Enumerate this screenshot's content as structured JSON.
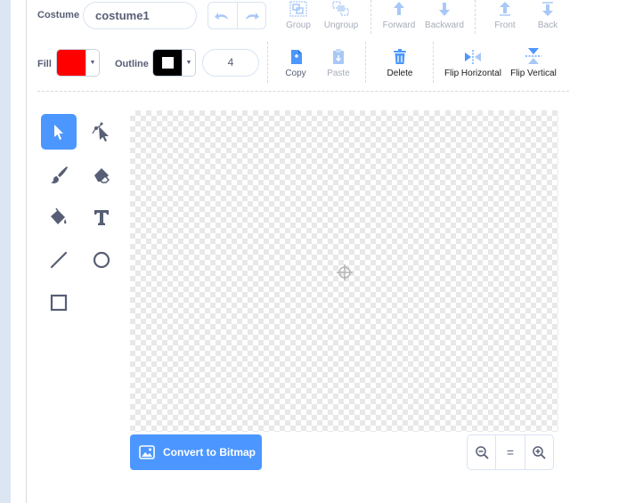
{
  "costume": {
    "label": "Costume",
    "name_value": "costume1"
  },
  "toolbar": {
    "group_label": "Group",
    "ungroup_label": "Ungroup",
    "forward_label": "Forward",
    "backward_label": "Backward",
    "front_label": "Front",
    "back_label": "Back",
    "copy_label": "Copy",
    "paste_label": "Paste",
    "delete_label": "Delete",
    "flip_horizontal_label": "Flip Horizontal",
    "flip_vertical_label": "Flip Vertical"
  },
  "style": {
    "fill_label": "Fill",
    "fill_color": "#ff0000",
    "outline_label": "Outline",
    "outline_color": "#000000",
    "outline_width": "4"
  },
  "tools": [
    "select-tool",
    "reshape-tool",
    "brush-tool",
    "eraser-tool",
    "fill-tool",
    "text-tool",
    "line-tool",
    "circle-tool",
    "rectangle-tool"
  ],
  "convert": {
    "label": "Convert to Bitmap"
  },
  "zoom": {
    "out": "zoom-out-icon",
    "reset": "=",
    "in": "zoom-in-icon"
  },
  "colors": {
    "accent": "#4c97ff",
    "text": "#575e75",
    "disabled": "#a6acb8"
  }
}
